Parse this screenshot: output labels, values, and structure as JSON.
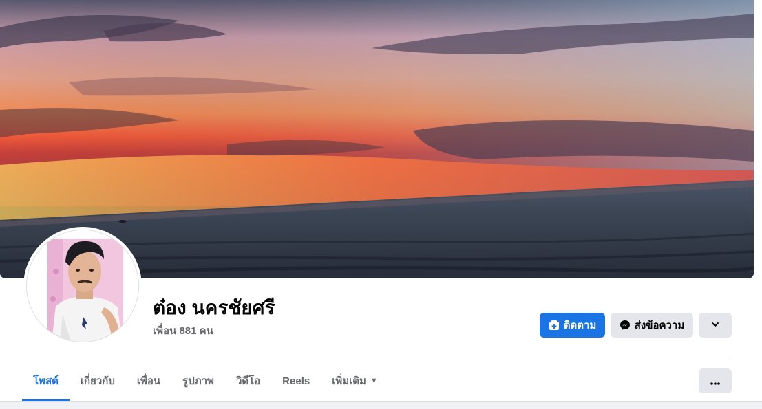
{
  "profile": {
    "name": "ต๋อง นครชัยศรี",
    "friends": "เพื่อน 881 คน"
  },
  "actions": {
    "follow_label": "ติดตาม",
    "message_label": "ส่งข้อความ"
  },
  "tabs": [
    {
      "label": "โพสต์",
      "active": true
    },
    {
      "label": "เกี่ยวกับ"
    },
    {
      "label": "เพื่อน"
    },
    {
      "label": "รูปภาพ"
    },
    {
      "label": "วิดีโอ"
    },
    {
      "label": "Reels"
    },
    {
      "label": "เพิ่มเติม"
    }
  ],
  "colors": {
    "accent": "#1b74e4",
    "secondary_button": "#e4e6eb",
    "muted_text": "#65676b"
  },
  "icons": [
    "follow-icon",
    "messenger-icon",
    "chevron-down-icon",
    "more-dots-icon",
    "caret-down-icon"
  ]
}
